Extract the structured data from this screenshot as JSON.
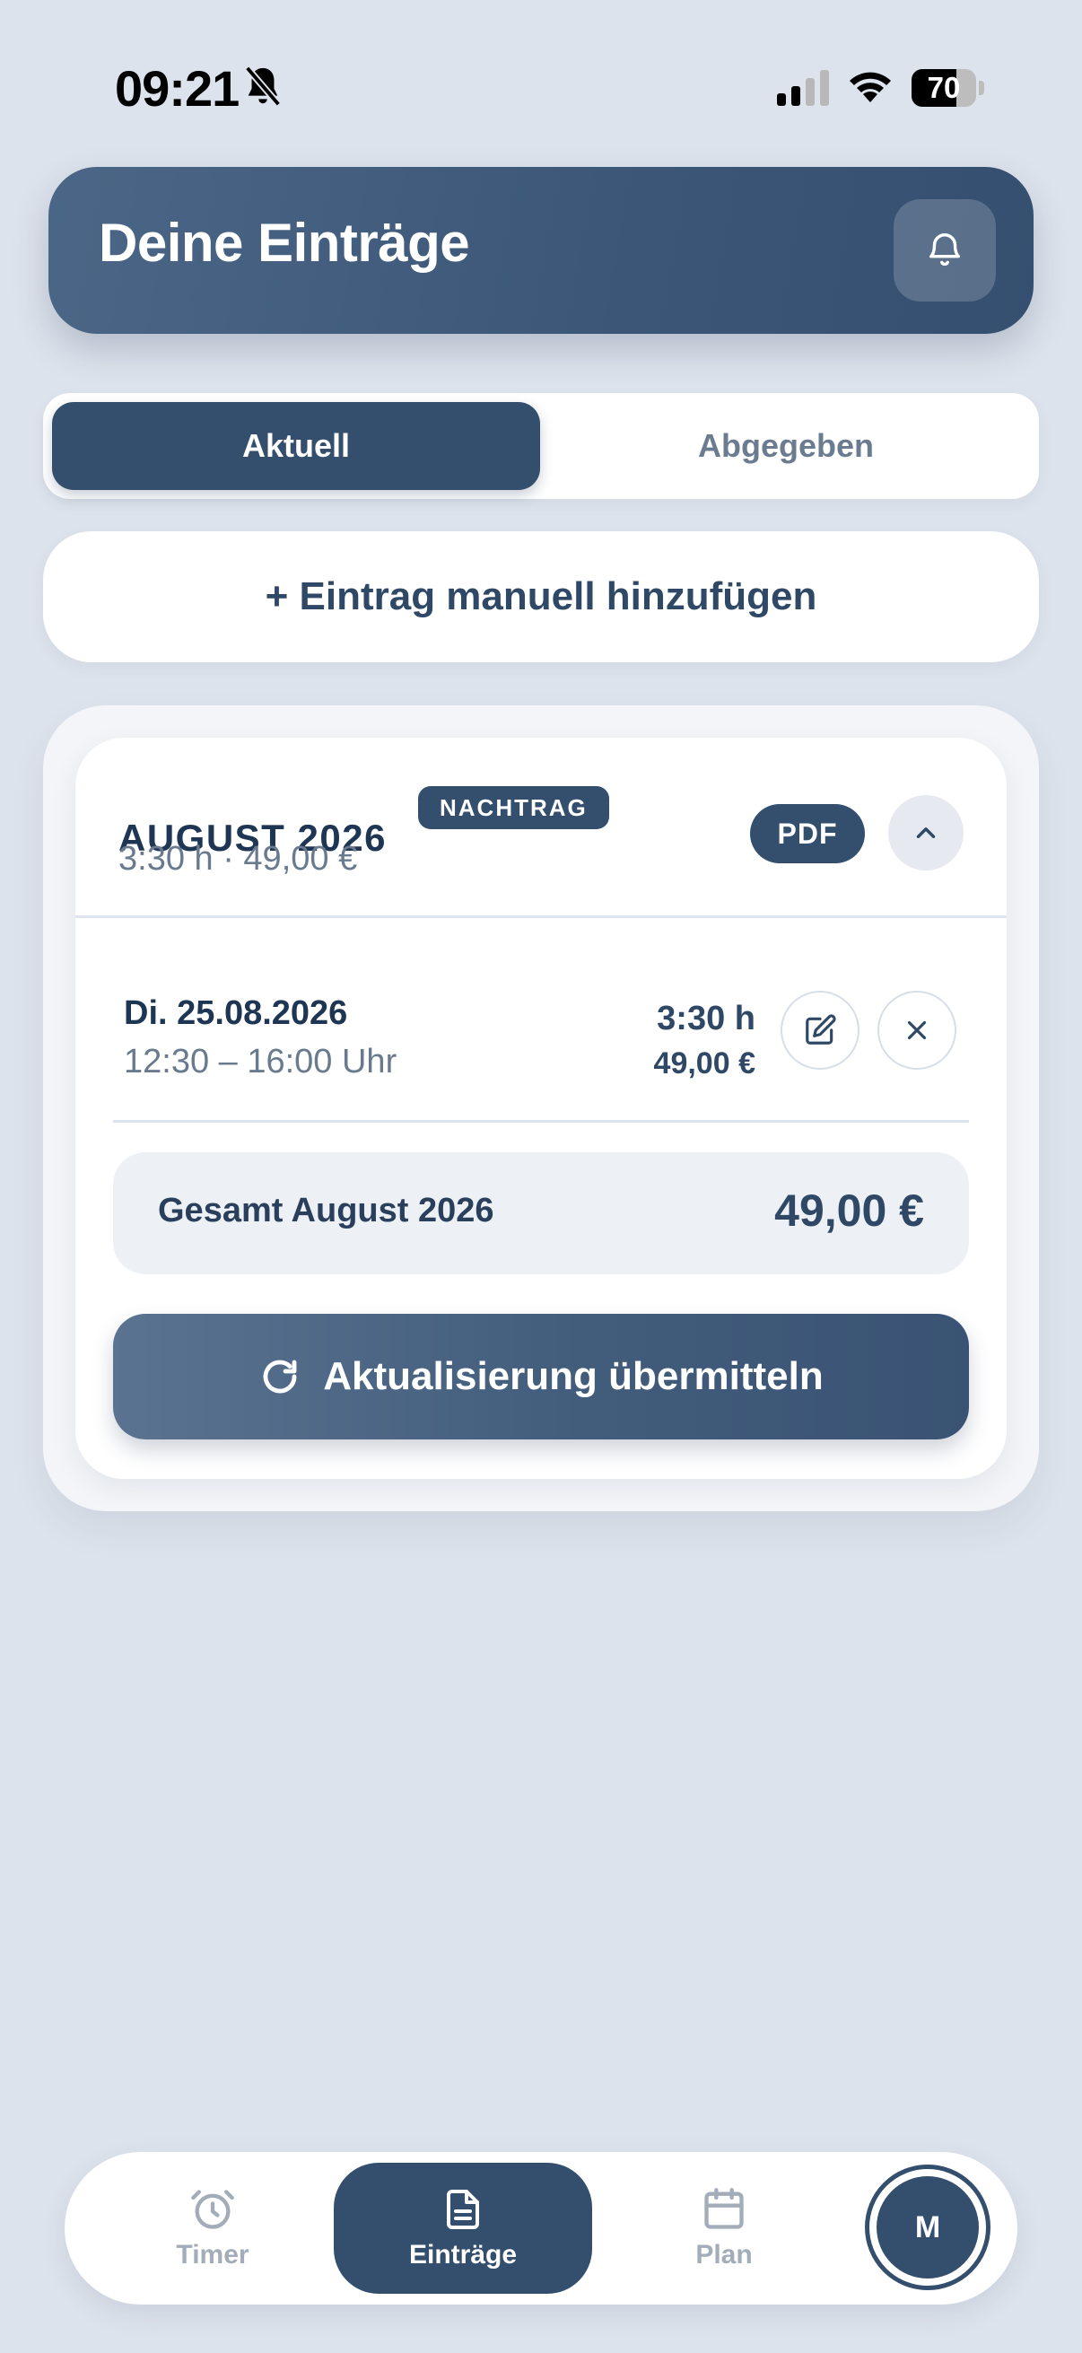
{
  "status_bar": {
    "time": "09:21",
    "battery": "70",
    "battery_level": 0.7
  },
  "header": {
    "title": "Deine Einträge"
  },
  "tabs": {
    "active": "Aktuell",
    "inactive": "Abgegeben"
  },
  "add_entry": {
    "label": "+ Eintrag manuell hinzufügen"
  },
  "month": {
    "title": "AUGUST 2026",
    "badge": "NACHTRAG",
    "summary": "3:30 h · 49,00 €",
    "pdf_label": "PDF",
    "entries": [
      {
        "date": "Di. 25.08.2026",
        "time": "12:30 – 16:00 Uhr",
        "hours": "3:30 h",
        "amount": "49,00 €"
      }
    ],
    "total_label": "Gesamt August 2026",
    "total_value": "49,00 €",
    "submit_label": "Aktualisierung übermitteln"
  },
  "nav": {
    "timer": "Timer",
    "entries": "Einträge",
    "plan": "Plan",
    "avatar_initial": "M"
  },
  "colors": {
    "primary": "#344e6e",
    "background": "#dde3ec",
    "muted": "#6a7a8e"
  }
}
